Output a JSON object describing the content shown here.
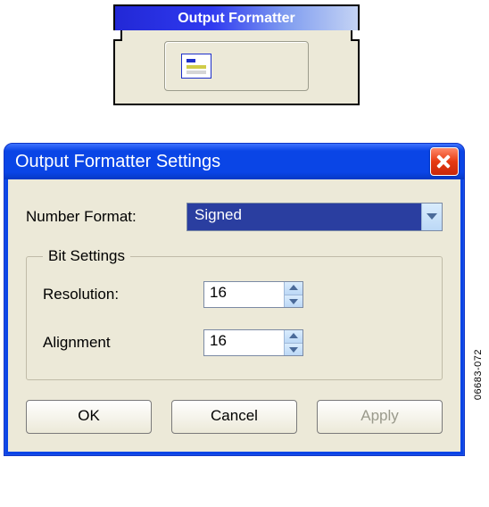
{
  "module": {
    "title": "Output Formatter"
  },
  "dialog": {
    "title": "Output Formatter Settings",
    "number_format": {
      "label": "Number Format:",
      "value": "Signed"
    },
    "bit_settings": {
      "legend": "Bit Settings",
      "resolution": {
        "label": "Resolution:",
        "value": "16"
      },
      "alignment": {
        "label": "Alignment",
        "value": "16"
      }
    },
    "buttons": {
      "ok": "OK",
      "cancel": "Cancel",
      "apply": "Apply"
    }
  },
  "figure_code": "06683-072"
}
